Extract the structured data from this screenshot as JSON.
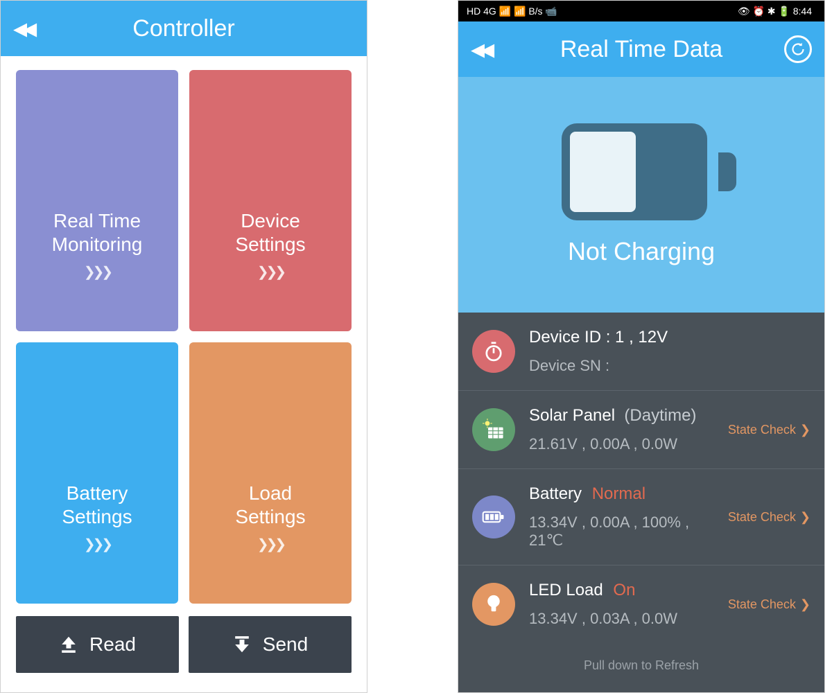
{
  "left": {
    "title": "Controller",
    "tiles": [
      {
        "label": "Real Time\nMonitoring"
      },
      {
        "label": "Device\nSettings"
      },
      {
        "label": "Battery\nSettings"
      },
      {
        "label": "Load\nSettings"
      }
    ],
    "chevrons": "❯❯❯",
    "bottom": {
      "read": "Read",
      "send": "Send"
    }
  },
  "right": {
    "title": "Real Time Data",
    "statusbar": {
      "left_text": "HD 4G 📶 📶 B/s 📹",
      "right_text": "👁 ⏰ ✱ 🔋 8:44",
      "time": "8:44"
    },
    "hero_status": "Not Charging",
    "rows": {
      "device": {
        "line1_label": "Device ID :",
        "line1_value": "1 , 12V",
        "line2_label": "Device SN :",
        "line2_value": ""
      },
      "solar": {
        "title": "Solar Panel",
        "extra": "(Daytime)",
        "values": "21.61V , 0.00A , 0.0W",
        "state_check": "State Check"
      },
      "battery": {
        "title": "Battery",
        "status": "Normal",
        "values": "13.34V , 0.00A , 100% , 21℃",
        "state_check": "State Check"
      },
      "load": {
        "title": "LED Load",
        "status": "On",
        "values": "13.34V , 0.03A , 0.0W",
        "state_check": "State Check"
      }
    },
    "pull_to_refresh": "Pull down to Refresh"
  }
}
